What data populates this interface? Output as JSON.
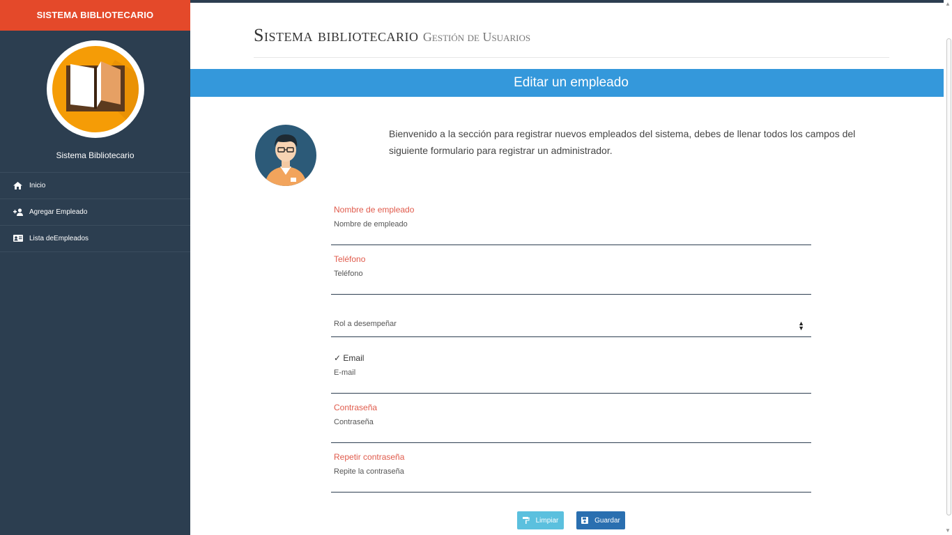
{
  "sidebar": {
    "brand": "SISTEMA BIBLIOTECARIO",
    "title": "Sistema Bibliotecario",
    "items": [
      {
        "label": "Inicio",
        "icon": "home-icon"
      },
      {
        "label": "Agregar Empleado",
        "icon": "add-user-icon"
      },
      {
        "label": "Lista deEmpleados",
        "icon": "id-card-icon"
      }
    ]
  },
  "header": {
    "title": "Sistema bibliotecario",
    "subtitle": "Gestión de Usuarios"
  },
  "panel": {
    "title": "Editar un empleado"
  },
  "intro": {
    "text": "Bienvenido a la sección para registrar nuevos empleados del sistema, debes de llenar todos los campos del siguiente formulario para registrar un administrador."
  },
  "form": {
    "name": {
      "label": "Nombre de empleado",
      "placeholder": "Nombre de empleado",
      "value": ""
    },
    "phone": {
      "label": "Teléfono",
      "placeholder": "Teléfono",
      "value": ""
    },
    "role": {
      "selected": "Rol a desempeñar"
    },
    "email": {
      "label": "✓ Email",
      "placeholder": "E-mail",
      "value": ""
    },
    "password": {
      "label": "Contraseña",
      "placeholder": "Contraseña",
      "value": ""
    },
    "password_repeat": {
      "label": "Repetir contraseña",
      "placeholder": "Repite la contraseña",
      "value": ""
    }
  },
  "buttons": {
    "clear": "Limpiar",
    "save": "Guardar"
  },
  "colors": {
    "brand": "#e4492a",
    "sidebar": "#2c3e50",
    "panel": "#3498db",
    "label_error": "#e05a4b",
    "btn_clear": "#5bc0de",
    "btn_save": "#2a6fb0"
  }
}
